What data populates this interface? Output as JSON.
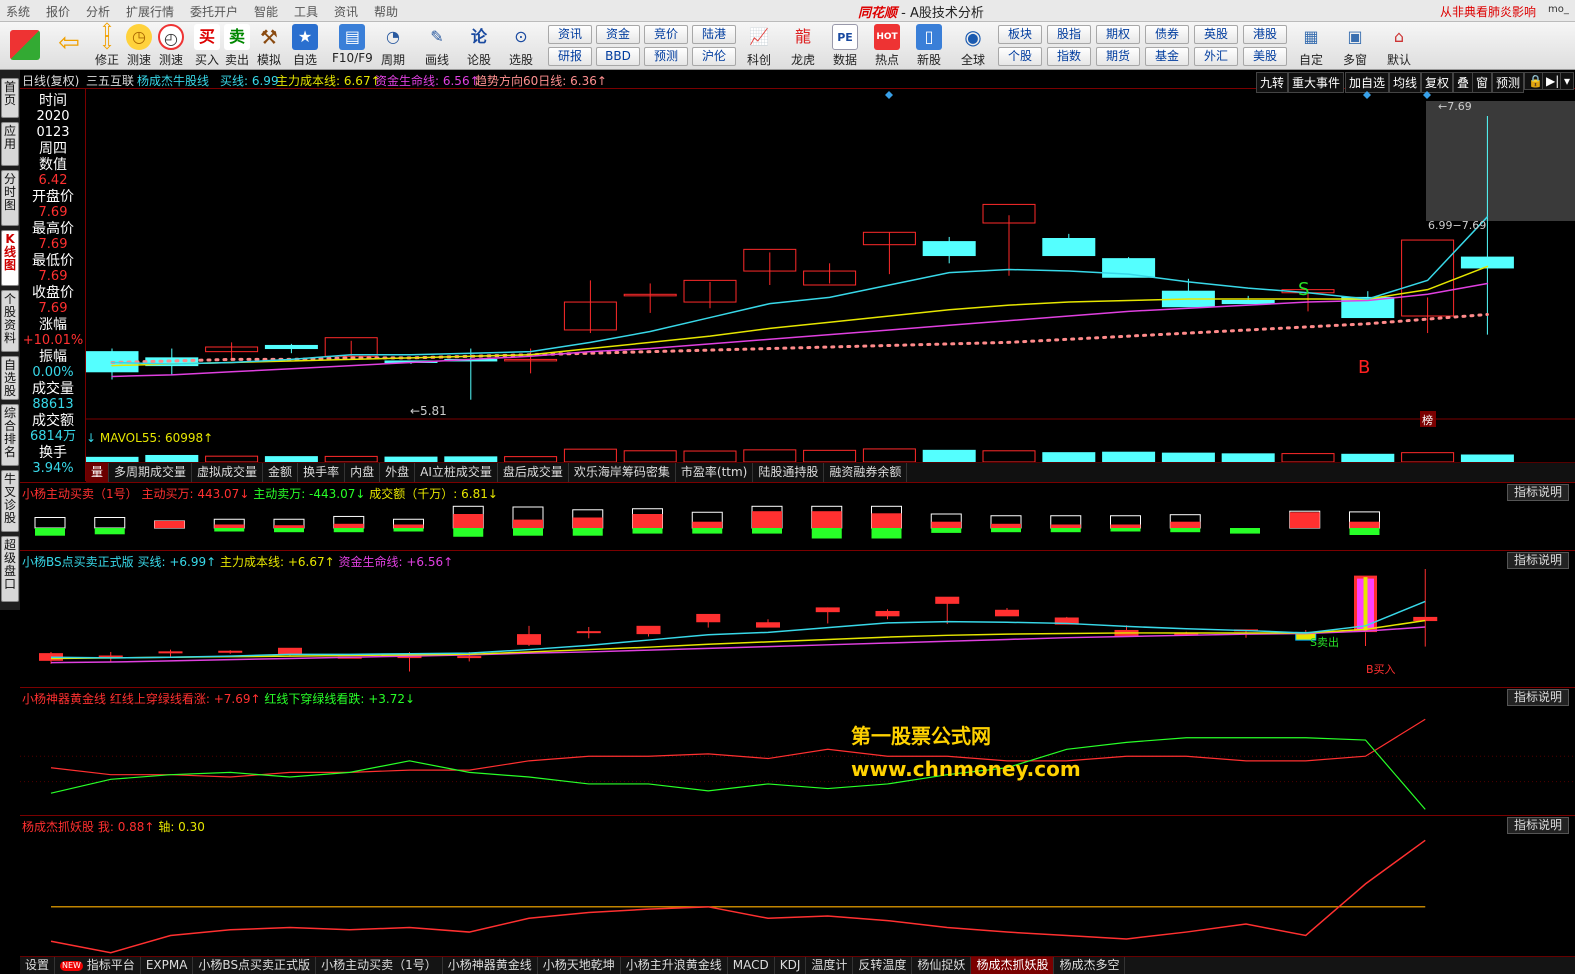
{
  "app": {
    "logo": "同花顺",
    "title": "- A股技术分析",
    "news": "从非典看肺炎影响",
    "user": "mo_"
  },
  "menu": [
    "系统",
    "报价",
    "分析",
    "扩展行情",
    "委托开户",
    "智能",
    "工具",
    "资讯",
    "帮助"
  ],
  "toolbar": {
    "left": [
      {
        "label": "修正",
        "icon": "up-down-arrow-icon"
      },
      {
        "label": "测速",
        "icon": "clock-icon"
      },
      {
        "label": "买入",
        "icon": "buy-icon",
        "glyph": "买"
      },
      {
        "label": "卖出",
        "icon": "sell-icon",
        "glyph": "卖"
      },
      {
        "label": "模拟",
        "icon": "gavel-icon"
      },
      {
        "label": "自选",
        "icon": "star-icon"
      },
      {
        "label": "F10/F9",
        "icon": "f10-icon"
      },
      {
        "label": "周期",
        "icon": "period-icon"
      },
      {
        "label": "画线",
        "icon": "pen-icon"
      },
      {
        "label": "论股",
        "icon": "discuss-icon"
      },
      {
        "label": "选股",
        "icon": "pick-icon"
      }
    ],
    "grid": [
      [
        "资讯",
        "研报"
      ],
      [
        "资金",
        "BBD"
      ],
      [
        "竞价",
        "预测"
      ],
      [
        "陆港",
        "沪伦"
      ]
    ],
    "mid": [
      {
        "label": "科创"
      },
      {
        "label": "龙虎"
      },
      {
        "label": "数据",
        "glyph": "PE"
      },
      {
        "label": "热点",
        "glyph": "HOT"
      },
      {
        "label": "新股"
      },
      {
        "label": "全球"
      }
    ],
    "grid2": [
      [
        "板块",
        "个股"
      ],
      [
        "股指",
        "指数"
      ],
      [
        "期权",
        "期货"
      ],
      [
        "债券",
        "基金"
      ],
      [
        "英股",
        "外汇"
      ],
      [
        "港股",
        "美股"
      ]
    ],
    "right": [
      {
        "label": "自定"
      },
      {
        "label": "多窗"
      },
      {
        "label": "默认"
      }
    ]
  },
  "sidenav": [
    "首页",
    "应用",
    "分时图",
    "K线图",
    "个股资料",
    "自选股",
    "综合排名",
    "牛叉诊股",
    "超级盘口"
  ],
  "header": {
    "period": "日线(复权)",
    "stock": "三五互联",
    "indicator": "杨成杰牛股线",
    "buy_line": "买线: 6.99",
    "cost_line": "主力成本线: 6.67↑",
    "life_line": "资金生命线: 6.56↑",
    "trend_line": "趋势方向60日线: 6.36↑",
    "right_tabs": [
      "九转",
      "重大事件",
      "加自选",
      "均线",
      "复权",
      "叠",
      "窗",
      "预测"
    ]
  },
  "datapanel": [
    {
      "label": "时间",
      "value": "2020"
    },
    {
      "label": "",
      "value": "0123"
    },
    {
      "label": "周四",
      "value": ""
    },
    {
      "label": "数值",
      "value": "6.42"
    },
    {
      "label": "开盘价",
      "value": "7.69"
    },
    {
      "label": "最高价",
      "value": "7.69"
    },
    {
      "label": "最低价",
      "value": "7.69"
    },
    {
      "label": "收盘价",
      "value": "7.69"
    },
    {
      "label": "涨幅",
      "value": "+10.01%"
    },
    {
      "label": "振幅",
      "value": "0.00%"
    },
    {
      "label": "成交量",
      "value": "88613"
    },
    {
      "label": "成交额",
      "value": "6814万"
    },
    {
      "label": "换手",
      "value": "3.94%"
    }
  ],
  "kline": {
    "hi_label": "←7.69",
    "lo_label": "←5.81",
    "range_label": "6.99−7.69",
    "s_mark": "S",
    "b_mark": "B",
    "bang": "榜",
    "chart_data": {
      "type": "candlestick",
      "candles": [
        {
          "o": 6.12,
          "h": 6.14,
          "l": 5.94,
          "c": 5.99
        },
        {
          "o": 6.08,
          "h": 6.14,
          "l": 5.97,
          "c": 6.03
        },
        {
          "o": 6.12,
          "h": 6.18,
          "l": 6.06,
          "c": 6.15
        },
        {
          "o": 6.16,
          "h": 6.17,
          "l": 6.11,
          "c": 6.14
        },
        {
          "o": 6.09,
          "h": 6.19,
          "l": 6.07,
          "c": 6.21
        },
        {
          "o": 6.06,
          "h": 6.06,
          "l": 6.04,
          "c": 6.05
        },
        {
          "o": 6.07,
          "h": 6.14,
          "l": 5.81,
          "c": 6.06
        },
        {
          "o": 6.07,
          "h": 6.14,
          "l": 5.98,
          "c": 6.07
        },
        {
          "o": 6.26,
          "h": 6.58,
          "l": 6.24,
          "c": 6.44
        },
        {
          "o": 6.48,
          "h": 6.56,
          "l": 6.37,
          "c": 6.49
        },
        {
          "o": 6.44,
          "h": 6.57,
          "l": 6.4,
          "c": 6.58
        },
        {
          "o": 6.64,
          "h": 6.76,
          "l": 6.55,
          "c": 6.78
        },
        {
          "o": 6.55,
          "h": 6.69,
          "l": 6.56,
          "c": 6.64
        },
        {
          "o": 6.81,
          "h": 6.89,
          "l": 6.62,
          "c": 6.89
        },
        {
          "o": 6.83,
          "h": 6.86,
          "l": 6.69,
          "c": 6.74
        },
        {
          "o": 6.95,
          "h": 7.0,
          "l": 6.61,
          "c": 7.07
        },
        {
          "o": 6.85,
          "h": 6.88,
          "l": 6.77,
          "c": 6.74
        },
        {
          "o": 6.72,
          "h": 6.73,
          "l": 6.62,
          "c": 6.6
        },
        {
          "o": 6.51,
          "h": 6.59,
          "l": 6.43,
          "c": 6.41
        },
        {
          "o": 6.45,
          "h": 6.48,
          "l": 6.43,
          "c": 6.43
        },
        {
          "o": 6.5,
          "h": 6.51,
          "l": 6.38,
          "c": 6.52
        },
        {
          "o": 6.47,
          "h": 6.51,
          "l": 6.42,
          "c": 6.34
        },
        {
          "o": 6.35,
          "h": 6.47,
          "l": 6.24,
          "c": 6.84
        },
        {
          "o": 6.73,
          "h": 7.64,
          "l": 6.23,
          "c": 6.66
        }
      ],
      "ma_buy": [
        6.05,
        6.04,
        6.05,
        6.07,
        6.1,
        6.1,
        6.11,
        6.12,
        6.18,
        6.25,
        6.34,
        6.43,
        6.47,
        6.55,
        6.63,
        6.65,
        6.64,
        6.62,
        6.57,
        6.53,
        6.5,
        6.46,
        6.58,
        6.99
      ],
      "ma_cost": [
        6.03,
        6.04,
        6.05,
        6.06,
        6.07,
        6.08,
        6.09,
        6.1,
        6.14,
        6.18,
        6.22,
        6.27,
        6.31,
        6.35,
        6.39,
        6.42,
        6.44,
        6.45,
        6.46,
        6.46,
        6.46,
        6.46,
        6.52,
        6.67
      ],
      "ma_life": [
        5.96,
        5.97,
        5.99,
        6.01,
        6.03,
        6.05,
        6.07,
        6.09,
        6.12,
        6.14,
        6.17,
        6.2,
        6.23,
        6.26,
        6.29,
        6.32,
        6.35,
        6.38,
        6.4,
        6.42,
        6.44,
        6.45,
        6.49,
        6.56
      ],
      "ma_trend": [
        6.05,
        6.06,
        6.07,
        6.07,
        6.08,
        6.08,
        6.09,
        6.1,
        6.11,
        6.12,
        6.13,
        6.14,
        6.15,
        6.16,
        6.17,
        6.18,
        6.2,
        6.22,
        6.24,
        6.26,
        6.28,
        6.3,
        6.33,
        6.36
      ],
      "ylim": [
        5.75,
        7.75
      ]
    }
  },
  "volume": {
    "title": "MAVOL55: 60998↑",
    "arrow": "↓",
    "chart_data": {
      "type": "bar",
      "values": [
        20,
        28,
        25,
        23,
        24,
        21,
        22,
        23,
        55,
        48,
        47,
        52,
        50,
        56,
        50,
        48,
        40,
        42,
        38,
        35,
        36,
        33,
        40,
        30
      ]
    }
  },
  "idxtabs": [
    "量",
    "多周期成交量",
    "虚拟成交量",
    "金额",
    "换手率",
    "内盘",
    "外盘",
    "AI立桩成交量",
    "盘后成交量",
    "欢乐海岸筹码密集",
    "市盈率(ttm)",
    "陆股通持股",
    "融资融券余额"
  ],
  "panel1": {
    "title": "小杨主动买卖（1号）",
    "t1": "主动买万: 443.07↓",
    "t2": "主动卖万: -443.07↓",
    "t3": "成交额（千万）: 6.81↓",
    "btn": "指标说明",
    "chart_data": {
      "type": "bar",
      "amount": [
        30,
        30,
        20,
        25,
        25,
        33,
        25,
        62,
        60,
        52,
        55,
        45,
        62,
        62,
        62,
        40,
        35,
        35,
        35,
        38,
        0,
        48,
        46
      ],
      "buy": [
        0,
        0,
        20,
        10,
        8,
        12,
        10,
        40,
        24,
        30,
        40,
        18,
        48,
        48,
        42,
        18,
        12,
        10,
        10,
        18,
        0,
        45,
        18
      ],
      "sell": [
        22,
        18,
        0,
        10,
        12,
        12,
        10,
        25,
        22,
        22,
        16,
        16,
        16,
        30,
        30,
        14,
        12,
        12,
        10,
        12,
        16,
        0,
        20
      ]
    }
  },
  "panel2": {
    "title": "小杨BS点买卖正式版",
    "t1": "买线: +6.99↑",
    "t2": "主力成本线: +6.67↑",
    "t3": "资金生命线: +6.56↑",
    "btn": "指标说明",
    "sell_mark": "S卖出",
    "buy_mark": "B买入"
  },
  "panel3": {
    "title": "小杨神器黄金线",
    "t1": "红线上穿绿线看涨: +7.69↑",
    "t2": "红线下穿绿线看跌: +3.72↓",
    "btn": "指标说明",
    "chart_data": {
      "type": "line",
      "red": [
        5.5,
        5.2,
        5.2,
        5.1,
        5.3,
        5.3,
        5.4,
        5.4,
        5.8,
        6.0,
        6.0,
        6.1,
        5.9,
        6.3,
        6.0,
        6.0,
        5.8,
        5.8,
        6.0,
        6.0,
        5.8,
        5.8,
        6.0,
        7.6
      ],
      "green": [
        4.4,
        5.0,
        5.2,
        5.3,
        5.1,
        5.3,
        5.8,
        5.3,
        5.1,
        4.8,
        4.8,
        4.5,
        4.8,
        4.6,
        4.8,
        5.2,
        5.5,
        6.3,
        6.6,
        6.8,
        6.8,
        6.8,
        6.7,
        3.7
      ],
      "ylim": [
        3.5,
        8.0
      ]
    }
  },
  "panel4": {
    "title": "杨成杰抓妖股",
    "t1": "我: 0.88↑",
    "t2": "轴: 0.30",
    "btn": "指标说明",
    "chart_data": {
      "type": "line",
      "wo": [
        0.0,
        -0.1,
        0.05,
        0.1,
        0.12,
        0.1,
        0.12,
        0.08,
        0.2,
        0.25,
        0.28,
        0.3,
        0.2,
        0.22,
        0.18,
        0.12,
        0.08,
        0.05,
        0.02,
        0.08,
        0.15,
        0.05,
        0.5,
        0.88
      ],
      "axis": 0.3,
      "ylim": [
        -0.12,
        0.9
      ]
    }
  },
  "watermark": {
    "line1": "第一股票公式网",
    "line2": "www.chnmoney.com"
  },
  "bottomtabs": [
    "设置",
    "指标平台",
    "EXPMA",
    "小杨BS点买卖正式版",
    "小杨主动买卖（1号）",
    "小杨神器黄金线",
    "小杨天地乾坤",
    "小杨主升浪黄金线",
    "MACD",
    "KDJ",
    "温度计",
    "反转温度",
    "杨仙捉妖",
    "杨成杰抓妖股",
    "杨成杰多空"
  ],
  "colors": {
    "up": "#ff2a2a",
    "down": "#54ffff",
    "cyan": "#38d8e8",
    "yellow": "#e6e600",
    "magenta": "#e040e0",
    "pinkdot": "#ff8a8a",
    "border": "#7a0000",
    "red": "#ff3030",
    "green": "#28ff28",
    "orange": "#ffb000",
    "white": "#ffffff"
  }
}
